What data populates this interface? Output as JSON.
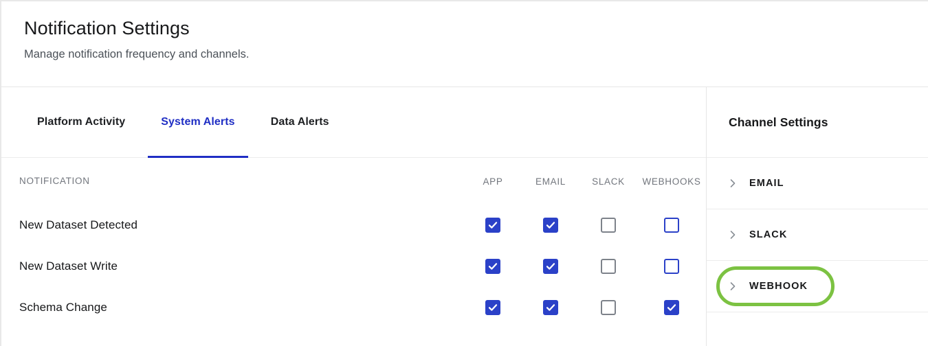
{
  "header": {
    "title": "Notification Settings",
    "subtitle": "Manage notification frequency and channels."
  },
  "tabs": [
    {
      "label": "Platform Activity",
      "active": false
    },
    {
      "label": "System Alerts",
      "active": true
    },
    {
      "label": "Data Alerts",
      "active": false
    }
  ],
  "table": {
    "columns": [
      "NOTIFICATION",
      "APP",
      "EMAIL",
      "SLACK",
      "WEBHOOKS"
    ],
    "rows": [
      {
        "name": "New Dataset Detected",
        "app": "checked",
        "email": "checked",
        "slack": "unchecked",
        "webhooks": "unchecked-focus"
      },
      {
        "name": "New Dataset Write",
        "app": "checked",
        "email": "checked",
        "slack": "unchecked",
        "webhooks": "unchecked-focus"
      },
      {
        "name": "Schema Change",
        "app": "checked",
        "email": "checked",
        "slack": "unchecked",
        "webhooks": "checked"
      }
    ]
  },
  "panel": {
    "title": "Channel Settings",
    "channels": [
      {
        "label": "EMAIL",
        "icon": "chevron-right-icon",
        "highlighted": false
      },
      {
        "label": "SLACK",
        "icon": "chevron-right-icon",
        "highlighted": false
      },
      {
        "label": "WEBHOOK",
        "icon": "chevron-right-icon",
        "highlighted": true
      }
    ]
  },
  "colors": {
    "accent_blue": "#2b41c8",
    "tab_active_blue": "#1f2ec4",
    "highlight_green": "#7cc242",
    "checkbox_unchecked_border": "#7d828a",
    "muted_text": "#72767d",
    "divider": "#e6e6e6"
  }
}
